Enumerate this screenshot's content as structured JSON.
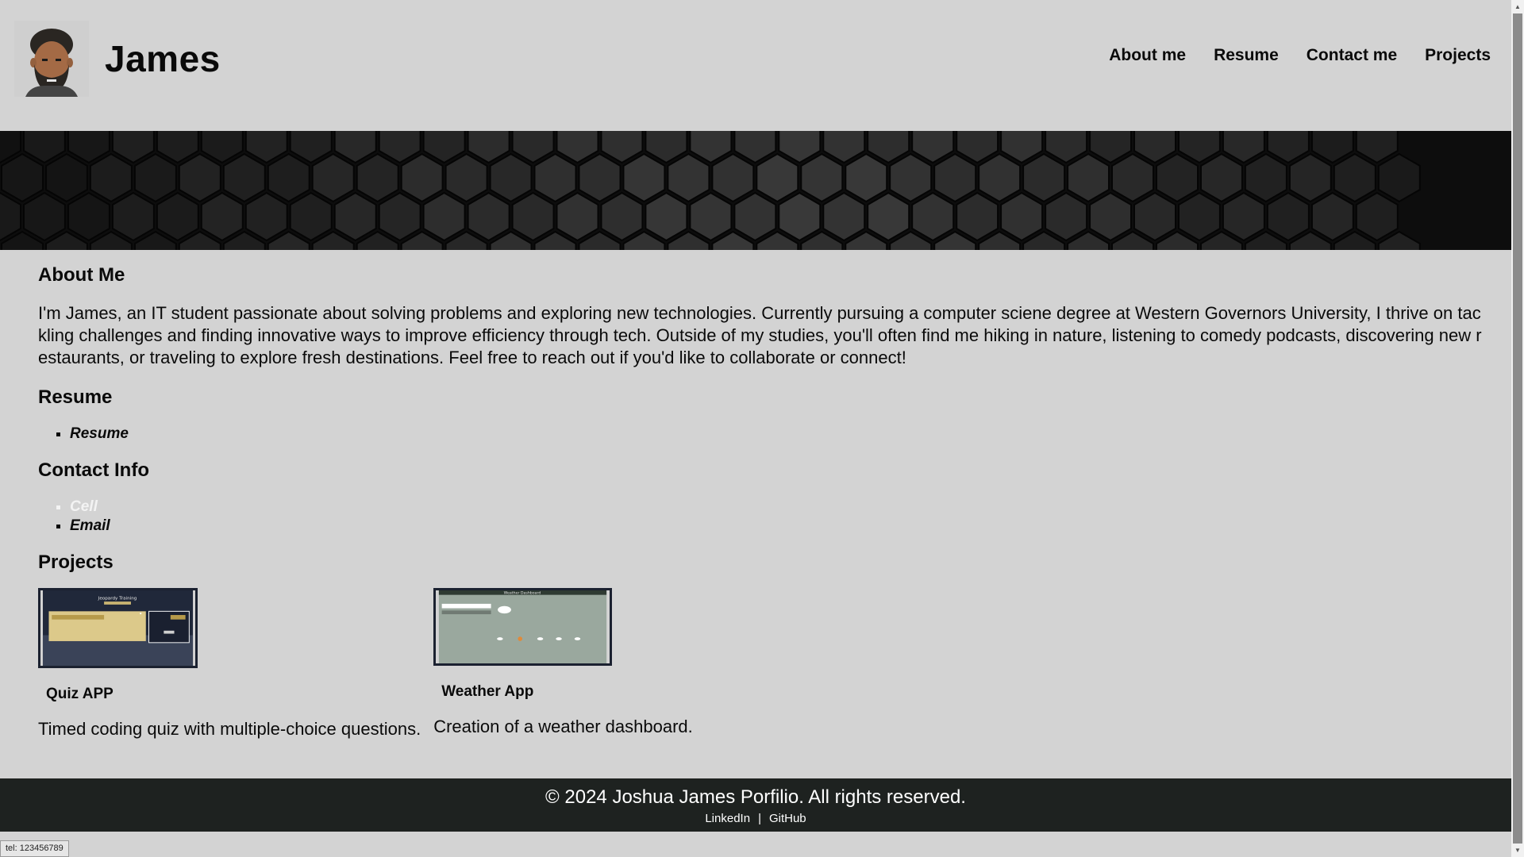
{
  "header": {
    "brand_name": "James",
    "nav": [
      "About me",
      "Resume",
      "Contact me",
      "Projects"
    ]
  },
  "about": {
    "heading": "About Me",
    "text": "I'm James, an IT student passionate about solving problems and exploring new technologies. Currently pursuing a computer sciene degree at Western Governors University, I thrive on tackling challenges and finding innovative ways to improve efficiency through tech. Outside of my studies, you'll often find me hiking in nature, listening to comedy podcasts, discovering new restaurants, or traveling to explore fresh destinations. Feel free to reach out if you'd like to collaborate or connect!"
  },
  "resume": {
    "heading": "Resume",
    "link": "Resume"
  },
  "contact": {
    "heading": "Contact Info",
    "cell": "Cell",
    "email": "Email"
  },
  "projects": {
    "heading": "Projects",
    "items": [
      {
        "title": "Quiz APP",
        "description": "Timed coding quiz with multiple-choice questions.",
        "thumb_caption": "Jeopardy Training"
      },
      {
        "title": "Weather App",
        "description": "Creation of a weather dashboard.",
        "thumb_caption": "Weather Dashboard"
      }
    ]
  },
  "footer": {
    "copyright": "© 2024 Joshua James Porfilio. All rights reserved.",
    "linkedin": "LinkedIn",
    "separator": "|",
    "github": "GitHub"
  },
  "status_bar": {
    "text": "tel: 123456789"
  },
  "colors": {
    "page_bg": "#d3d3d3",
    "hero_bg": "#0d0d0d",
    "footer_bg": "#1e2220",
    "thumb_border": "#1b2130"
  }
}
